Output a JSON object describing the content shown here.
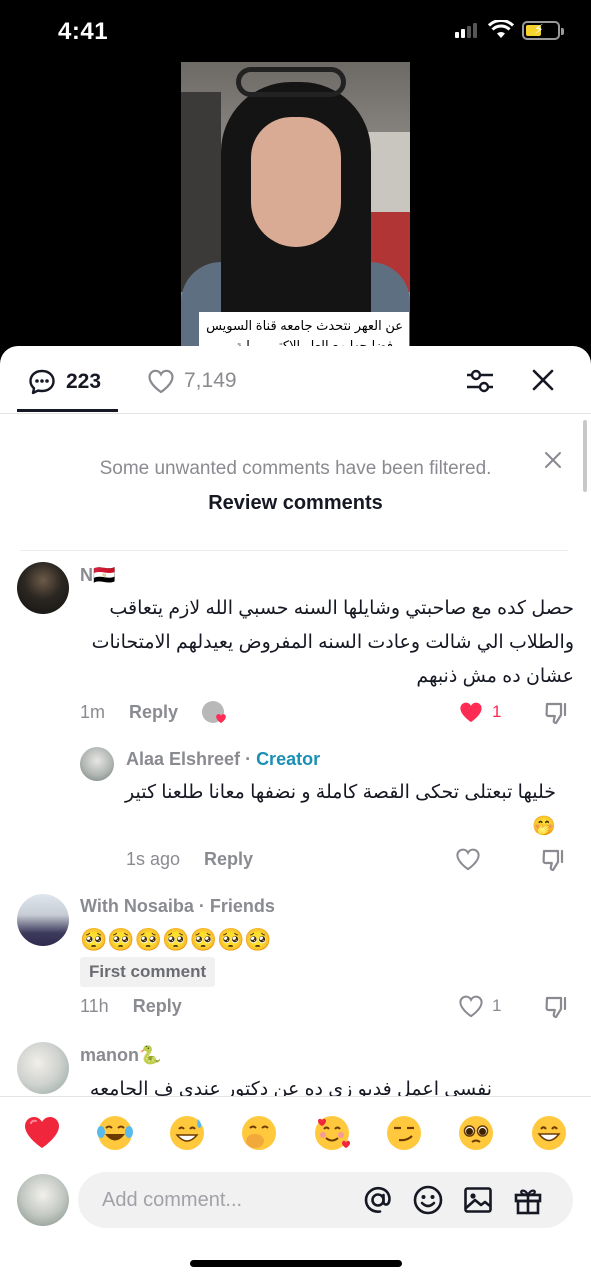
{
  "status_bar": {
    "time": "4:41"
  },
  "video": {
    "caption": "عن العهر نتحدث جامعه قناة السويس و فضايحها مع العلو الاكتور رواية"
  },
  "header": {
    "comment_count": "223",
    "like_count": "7,149",
    "icons": [
      "comment-icon",
      "heart-outline-icon",
      "sliders-icon",
      "close-icon"
    ]
  },
  "notice": {
    "message": "Some unwanted comments have been filtered.",
    "review_label": "Review comments"
  },
  "comments": [
    {
      "username": "N🇪🇬",
      "text": "حصل كده مع صاحبتي وشايلها السنه حسبي الله لازم يتعاقب والطلاب الي شالت وعادت السنه المفروض يعيدلهم الامتحانات عشان ده مش ذنبهم",
      "time": "1m",
      "reply_label": "Reply",
      "likes": "1"
    },
    {
      "username": "Alaa Elshreef",
      "separator": " · ",
      "badge": "Creator",
      "text": "خليها تبعتلى تحكى القصة كاملة و نضفها معانا طلعنا كتير 🤭",
      "time": "1s ago",
      "reply_label": "Reply"
    },
    {
      "username": "With Nosaiba · Friends",
      "text": "🥺🥺🥺🥺🥺🥺🥺",
      "badge": "First comment",
      "time": "11h",
      "reply_label": "Reply",
      "likes": "1"
    },
    {
      "username": "manon🐍",
      "text": "نفسي اعمل فديو زي ده عن دكتور عندي ف الجامعه بجد"
    }
  ],
  "emoji_bar": [
    "heart",
    "tears-of-joy",
    "grinning-sweat",
    "hand-over-mouth",
    "smiling-hearts",
    "smirk",
    "pleading",
    "grinning"
  ],
  "compose": {
    "placeholder": "Add comment...",
    "icons": [
      "at-icon",
      "emoji-icon",
      "image-icon",
      "gift-icon"
    ]
  },
  "colors": {
    "accent_like": "#fe2c55",
    "creator": "#1c8fb5",
    "muted": "#8a8b91"
  }
}
